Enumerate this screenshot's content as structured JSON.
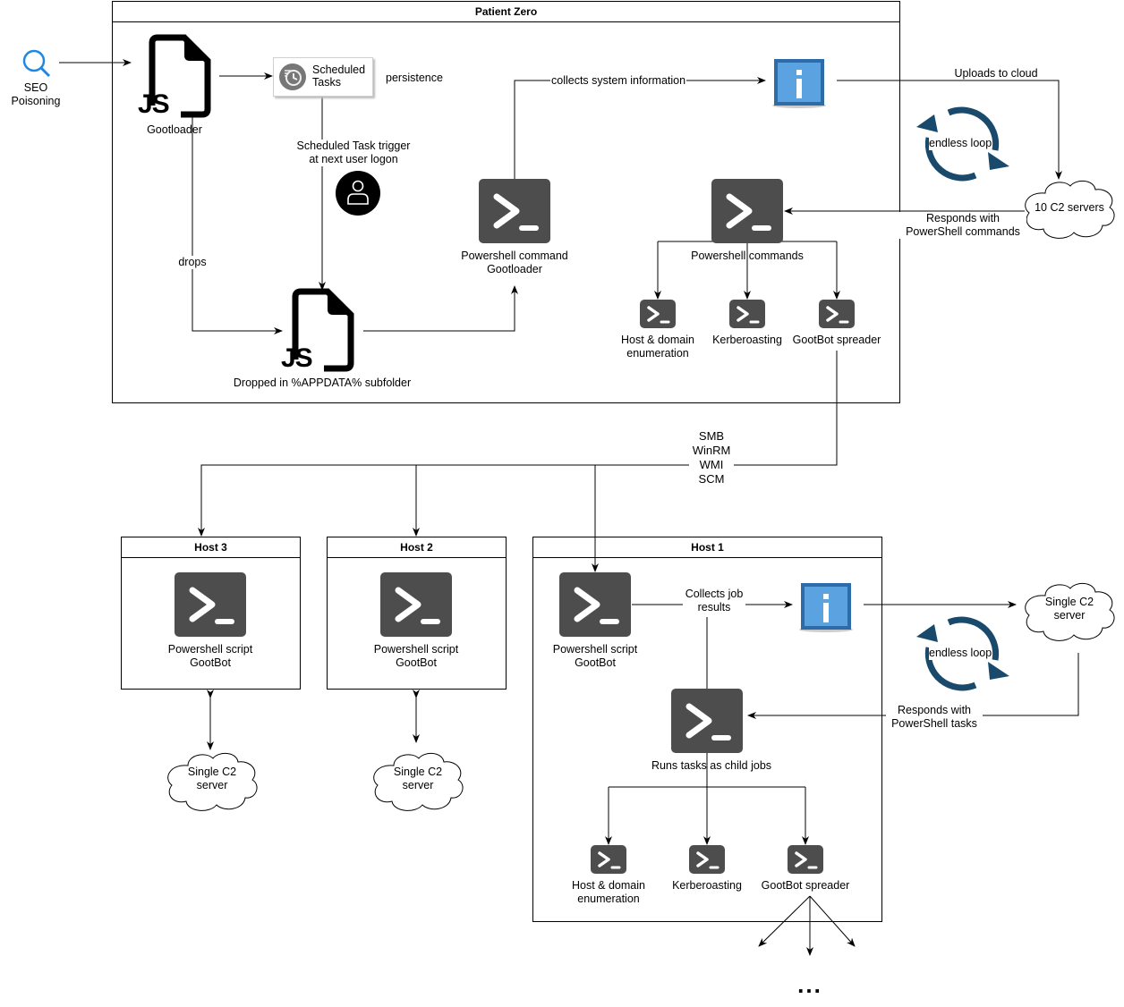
{
  "entry": {
    "label_line1": "SEO",
    "label_line2": "Poisoning",
    "icon": "search-icon",
    "accent": "#1e88e5"
  },
  "patient_zero": {
    "title": "Patient Zero",
    "gootloader_label": "Gootloader",
    "js_glyph": "JS",
    "scheduled_tasks": {
      "line1": "Scheduled",
      "line2": "Tasks"
    },
    "persistence_label": "persistence",
    "trigger_label_line1": "Scheduled Task trigger",
    "trigger_label_line2": "at next user logon",
    "drops_label": "drops",
    "dropped_label": "Dropped in %APPDATA% subfolder",
    "ps_gootloader_line1": "Powershell command",
    "ps_gootloader_line2": "Gootloader",
    "collects_label": "collects system information",
    "uploads_label": "Uploads to cloud",
    "endless_loop_label": "endless loop",
    "c2_label": "10 C2 servers",
    "responds_line1": "Responds with",
    "responds_line2": "PowerShell commands",
    "ps_commands_label": "Powershell commands",
    "tasks": [
      {
        "line1": "Host & domain",
        "line2": "enumeration"
      },
      {
        "line1": "Kerberoasting",
        "line2": ""
      },
      {
        "line1": "GootBot spreader",
        "line2": ""
      }
    ]
  },
  "lateral": {
    "protocols": [
      "SMB",
      "WinRM",
      "WMI",
      "SCM"
    ]
  },
  "hosts": [
    {
      "title": "Host 3",
      "ps_line1": "Powershell script",
      "ps_line2": "GootBot",
      "c2_line1": "Single C2",
      "c2_line2": "server"
    },
    {
      "title": "Host 2",
      "ps_line1": "Powershell script",
      "ps_line2": "GootBot",
      "c2_line1": "Single C2",
      "c2_line2": "server"
    }
  ],
  "host1": {
    "title": "Host 1",
    "ps_line1": "Powershell script",
    "ps_line2": "GootBot",
    "collects_line1": "Collects job",
    "collects_line2": "results",
    "c2_line1": "Single C2",
    "c2_line2": "server",
    "endless_loop_label": "endless loop",
    "responds_line1": "Responds with",
    "responds_line2": "PowerShell tasks",
    "runs_label": "Runs tasks as child jobs",
    "tasks": [
      {
        "line1": "Host & domain",
        "line2": "enumeration"
      },
      {
        "line1": "Kerberoasting",
        "line2": ""
      },
      {
        "line1": "GootBot spreader",
        "line2": ""
      }
    ],
    "ellipsis": "..."
  },
  "colors": {
    "powershell_bg": "#4d4d4d",
    "loop_color": "#1a4a6b",
    "info_blue": "#4a90d9"
  }
}
